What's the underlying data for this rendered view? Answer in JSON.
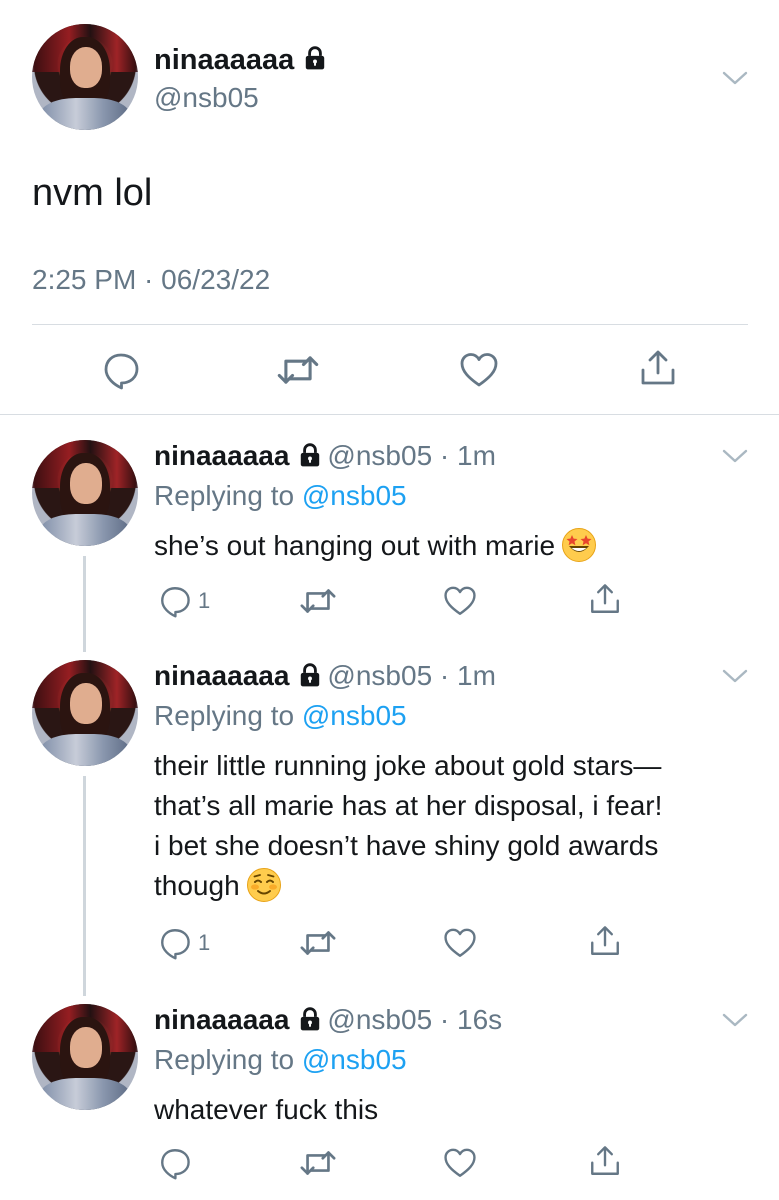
{
  "main_tweet": {
    "display_name": "ninaaaaaa",
    "handle": "@nsb05",
    "text": "nvm lol",
    "timestamp": "2:25 PM · 06/23/22"
  },
  "replies": [
    {
      "display_name": "ninaaaaaa",
      "meta": "@nsb05 · 1m",
      "replying_prefix": "Replying to ",
      "replying_to": "@nsb05",
      "lines": [
        "she’s out hanging out with marie"
      ],
      "emoji": "star-struck-emoji",
      "reply_count": "1"
    },
    {
      "display_name": "ninaaaaaa",
      "meta": "@nsb05 · 1m",
      "replying_prefix": "Replying to ",
      "replying_to": "@nsb05",
      "lines": [
        "their little running joke about gold stars—",
        "that’s all marie has at her disposal, i fear!",
        "i bet she doesn’t have shiny gold awards",
        "though"
      ],
      "emoji": "smiling-blush-emoji",
      "reply_count": "1"
    },
    {
      "display_name": "ninaaaaaa",
      "meta": "@nsb05 · 16s",
      "replying_prefix": "Replying to ",
      "replying_to": "@nsb05",
      "lines": [
        "whatever fuck this"
      ],
      "emoji": "",
      "reply_count": ""
    }
  ],
  "colors": {
    "primary_text": "#14171a",
    "secondary_text": "#657786",
    "link": "#1da1f2",
    "divider": "#d8dde2"
  },
  "icons": [
    "lock-icon",
    "chevron-down-icon",
    "reply-icon",
    "retweet-icon",
    "like-icon",
    "share-icon"
  ]
}
